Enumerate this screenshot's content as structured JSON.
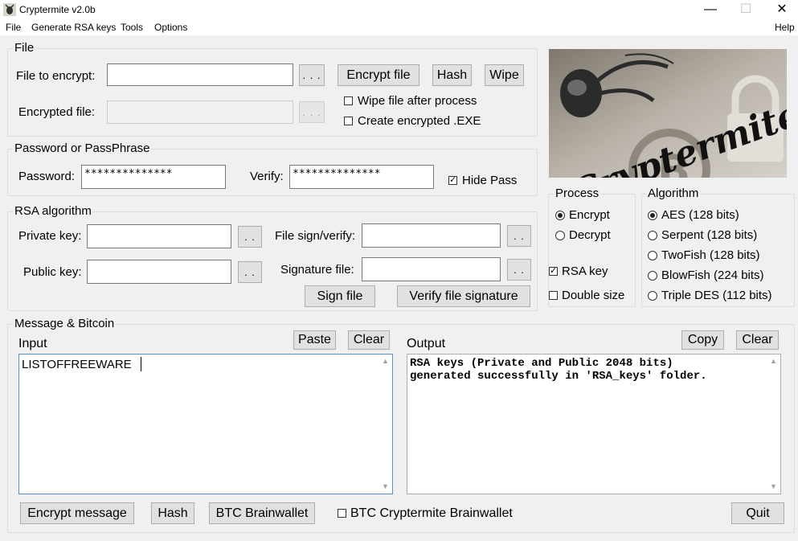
{
  "window": {
    "title": "Cryptermite v2.0b",
    "controls": {
      "minimize": "—",
      "maximize": "☐",
      "close": "✕"
    }
  },
  "menu": {
    "items": [
      "File",
      "Generate RSA keys",
      "Tools",
      "Options"
    ],
    "help": "Help"
  },
  "file_group": {
    "title": "File",
    "file_to_encrypt_label": "File to encrypt:",
    "file_to_encrypt_value": "",
    "encrypted_file_label": "Encrypted file:",
    "encrypted_file_value": "",
    "browse_label": ". . .",
    "encrypt_file_button": "Encrypt file",
    "hash_button": "Hash",
    "wipe_button": "Wipe",
    "wipe_after_label": "Wipe file after process",
    "wipe_after_checked": false,
    "create_exe_label": "Create encrypted .EXE",
    "create_exe_checked": false
  },
  "password_group": {
    "title": "Password or PassPhrase",
    "password_label": "Password:",
    "password_value": "**************",
    "verify_label": "Verify:",
    "verify_value": "**************",
    "hide_pass_label": "Hide Pass",
    "hide_pass_checked": true
  },
  "rsa_group": {
    "title": "RSA algorithm",
    "private_key_label": "Private key:",
    "public_key_label": "Public key:",
    "file_sign_label": "File sign/verify:",
    "signature_file_label": "Signature file:",
    "browse_label": ". .",
    "sign_file_button": "Sign file",
    "verify_signature_button": "Verify file signature"
  },
  "logo": {
    "text": "Cryptermite"
  },
  "process_group": {
    "title": "Process",
    "options": [
      {
        "label": "Encrypt",
        "selected": true
      },
      {
        "label": "Decrypt",
        "selected": false
      }
    ],
    "rsa_key_label": "RSA key",
    "rsa_key_checked": true,
    "double_size_label": "Double size",
    "double_size_checked": false
  },
  "algorithm_group": {
    "title": "Algorithm",
    "options": [
      {
        "label": "AES (128 bits)",
        "selected": true
      },
      {
        "label": "Serpent (128 bits)",
        "selected": false
      },
      {
        "label": "TwoFish (128 bits)",
        "selected": false
      },
      {
        "label": "BlowFish (224 bits)",
        "selected": false
      },
      {
        "label": "Triple DES (112 bits)",
        "selected": false
      }
    ]
  },
  "message_group": {
    "title": "Message & Bitcoin",
    "input_label": "Input",
    "input_text": "LISTOFFREEWARE",
    "paste_button": "Paste",
    "clear_button": "Clear",
    "output_label": "Output",
    "output_text": "RSA keys (Private and Public 2048 bits)\ngenerated successfully in 'RSA_keys' folder.",
    "copy_button": "Copy",
    "output_clear_button": "Clear",
    "encrypt_message_button": "Encrypt message",
    "hash_button": "Hash",
    "btc_brainwallet_button": "BTC Brainwallet",
    "btc_cryptermite_label": "BTC Cryptermite Brainwallet",
    "btc_cryptermite_checked": false,
    "quit_button": "Quit"
  }
}
